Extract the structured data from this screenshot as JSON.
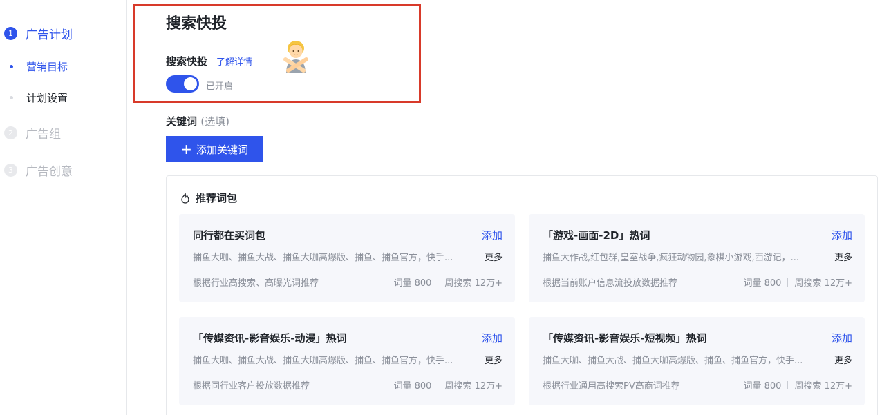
{
  "sidebar": {
    "steps": [
      {
        "num": "1",
        "label": "广告计划"
      },
      {
        "num": "2",
        "label": "广告组"
      },
      {
        "num": "3",
        "label": "广告创意"
      }
    ],
    "subitems": [
      {
        "label": "营销目标"
      },
      {
        "label": "计划设置"
      }
    ]
  },
  "search_fast": {
    "title": "搜索快投",
    "label": "搜索快投",
    "link": "了解详情",
    "toggle_on": true,
    "toggle_text": "已开启"
  },
  "keywords": {
    "label": "关键词",
    "hint": "(选填)",
    "add_button": "添加关键词"
  },
  "recommend": {
    "title": "推荐词包",
    "add_label": "添加",
    "more_label": "更多",
    "cards": [
      {
        "title": "同行都在买词包",
        "words": "捕鱼大咖、捕鱼大战、捕鱼大咖高爆版、捕鱼、捕鱼官方，快手...",
        "source": "根据行业高搜索、高曝光词推荐",
        "count": "词量 800",
        "search": "周搜索 12万+"
      },
      {
        "title": "「游戏-画面-2D」热词",
        "words": "捕鱼大作战,红包群,皇室战争,疯狂动物园,象棋小游戏,西游记，...",
        "source": "根据当前账户信息流投放数据推荐",
        "count": "词量 800",
        "search": "周搜索 12万+"
      },
      {
        "title": "「传媒资讯-影音娱乐-动漫」热词",
        "words": "捕鱼大咖、捕鱼大战、捕鱼大咖高爆版、捕鱼、捕鱼官方，快手...",
        "source": "根据同行业客户投放数据推荐",
        "count": "词量 800",
        "search": "周搜索 12万+"
      },
      {
        "title": "「传媒资讯-影音娱乐-短视频」热词",
        "words": "捕鱼大咖、捕鱼大战、捕鱼大咖高爆版、捕鱼、捕鱼官方，快手...",
        "source": "根据行业通用高搜索PV高商词推荐",
        "count": "词量 800",
        "search": "周搜索 12万+"
      }
    ]
  },
  "colors": {
    "primary": "#2f54eb",
    "highlight_border": "#d83a2a",
    "card_bg": "#f6f7fb"
  },
  "icons": {
    "emoji": "person-gesturing-no-icon",
    "panel": "flame-icon"
  }
}
